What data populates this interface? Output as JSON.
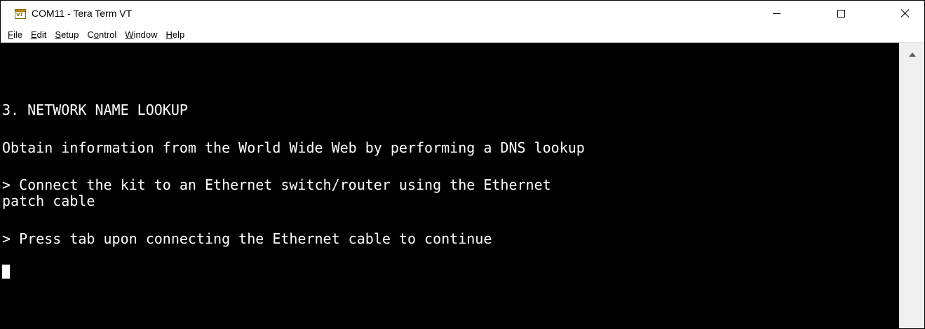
{
  "window": {
    "title": "COM11 - Tera Term VT",
    "icon": "tera-term-vt-icon",
    "icon_text": "VT",
    "controls": {
      "minimize": "minimize-icon",
      "maximize": "maximize-icon",
      "close": "close-icon"
    }
  },
  "menu": {
    "items": [
      {
        "first": "F",
        "rest": "ile",
        "pre": ""
      },
      {
        "first": "E",
        "rest": "dit",
        "pre": ""
      },
      {
        "first": "S",
        "rest": "etup",
        "pre": ""
      },
      {
        "pre": "C",
        "first": "o",
        "rest": "ntrol"
      },
      {
        "first": "W",
        "rest": "indow",
        "pre": ""
      },
      {
        "first": "H",
        "rest": "elp",
        "pre": ""
      }
    ]
  },
  "terminal": {
    "lines": [
      "3. NETWORK NAME LOOKUP",
      "Obtain information from the World Wide Web by performing a DNS lookup",
      "> Connect the kit to an Ethernet switch/router using the Ethernet",
      "patch cable",
      "> Press tab upon connecting the Ethernet cable to continue"
    ],
    "colors": {
      "background": "#000000",
      "foreground": "#ffffff"
    }
  },
  "scrollbar": {
    "up_icon": "chevron-up-icon"
  }
}
